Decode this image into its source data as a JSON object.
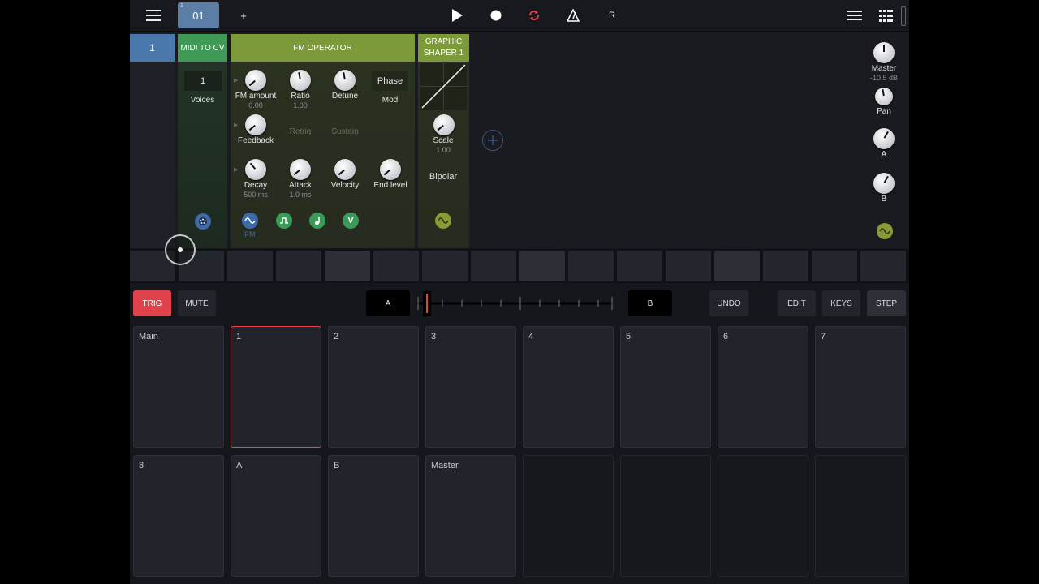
{
  "toolbar": {
    "pattern_label": "01",
    "pattern_sup": "1",
    "add_label": "+",
    "r_label": "R",
    "loop_color": "#e0424c"
  },
  "rack": {
    "track_number": "1",
    "midi_cv": {
      "title": "MIDI TO CV",
      "voices_value": "1",
      "voices_label": "Voices"
    },
    "fm_operator": {
      "title": "FM OPERATOR",
      "knobs": [
        {
          "label": "FM amount",
          "value": "0.00"
        },
        {
          "label": "Ratio",
          "value": "1.00"
        },
        {
          "label": "Detune",
          "value": ""
        },
        {
          "label": "Feedback",
          "value": ""
        },
        {
          "label": "Decay",
          "value": "500 ms"
        },
        {
          "label": "Attack",
          "value": "1.0 ms"
        },
        {
          "label": "Velocity",
          "value": ""
        },
        {
          "label": "End level",
          "value": ""
        }
      ],
      "phase_label": "Phase",
      "mod_label": "Mod",
      "retrig_label": "Retrig",
      "sustain_label": "Sustain",
      "fm_caption": "FM",
      "mod_buttons": [
        "~",
        "⎍",
        "♪",
        "V"
      ]
    },
    "graphic_shaper": {
      "title_line1": "GRAPHIC",
      "title_line2": "SHAPER 1",
      "scale_label": "Scale",
      "scale_value": "1.00",
      "bipolar_label": "Bipolar"
    },
    "mixer": {
      "master_label": "Master",
      "master_value": "-10.5 dB",
      "pan_label": "Pan",
      "a_label": "A",
      "b_label": "B"
    }
  },
  "controls": {
    "trig": "TRIG",
    "mute": "MUTE",
    "scene_a": "A",
    "scene_b": "B",
    "undo": "UNDO",
    "edit": "EDIT",
    "keys": "KEYS",
    "step": "STEP",
    "trig_color": "#e0424c"
  },
  "pads": {
    "row1": [
      "Main",
      "1",
      "2",
      "3",
      "4",
      "5",
      "6",
      "7"
    ],
    "row2": [
      "8",
      "A",
      "B",
      "Master",
      "",
      "",
      "",
      ""
    ],
    "selected": "1"
  }
}
